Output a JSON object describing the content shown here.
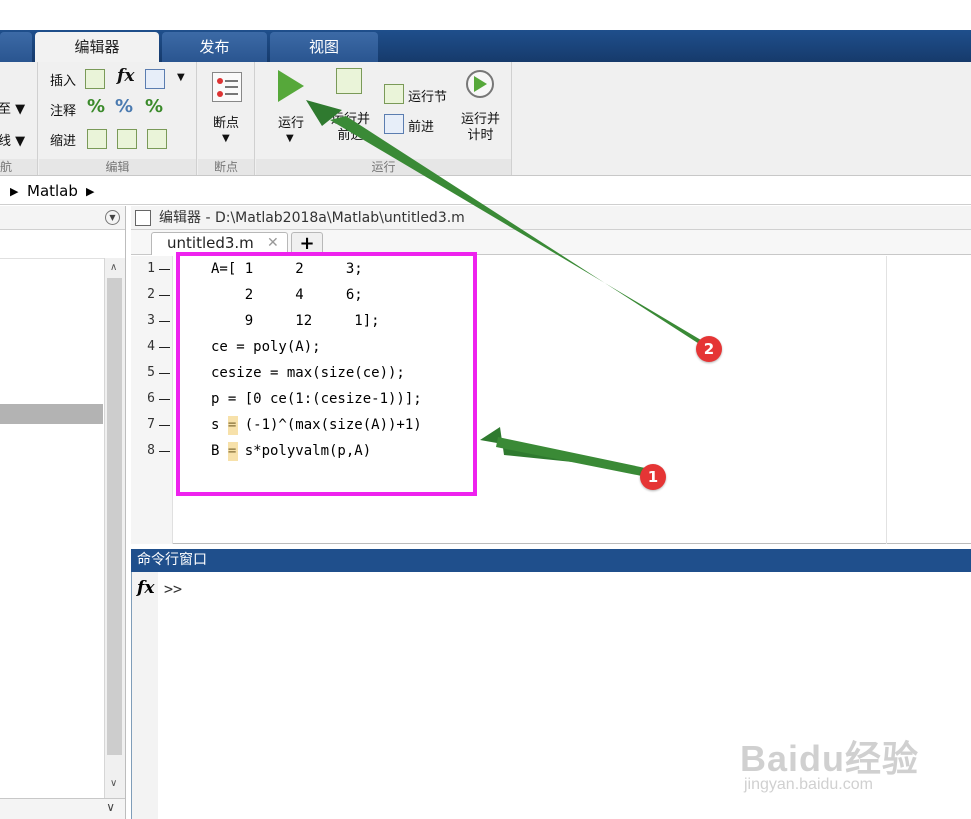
{
  "tabs": [
    {
      "label": "编辑器",
      "active": true
    },
    {
      "label": "发布",
      "active": false
    },
    {
      "label": "视图",
      "active": false
    }
  ],
  "ribbon": {
    "left_partial": [
      "至 ▼",
      "线 ▼",
      "航"
    ],
    "edit_section": {
      "title": "编辑",
      "insert_label": "插入",
      "comment_label": "注释",
      "indent_label": "缩进",
      "fx_label": "fx"
    },
    "breakpoint_section": {
      "title": "断点",
      "button_label": "断点"
    },
    "run_section": {
      "title": "运行",
      "run_label": "运行",
      "run_advance_label": "运行并\n前进",
      "run_section_label": "运行节",
      "advance_label": "前进",
      "run_time_label": "运行并\n计时"
    }
  },
  "breadcrumb": [
    "Matlab"
  ],
  "editor": {
    "header": "编辑器 - D:\\Matlab2018a\\Matlab\\untitled3.m",
    "tab": "untitled3.m",
    "add_tab": "+",
    "lines": [
      {
        "n": "1",
        "code": "A=[ 1     2     3;"
      },
      {
        "n": "2",
        "code": "    2     4     6;"
      },
      {
        "n": "3",
        "code": "    9     12     1];"
      },
      {
        "n": "4",
        "code": "ce = poly(A);"
      },
      {
        "n": "5",
        "code": "cesize = max(size(ce));"
      },
      {
        "n": "6",
        "code": "p = [0 ce(1:(cesize-1))];"
      },
      {
        "n": "7",
        "code": "s = (-1)^(max(size(A))+1)"
      },
      {
        "n": "8",
        "code": "B = s*polyvalm(p,A)"
      }
    ]
  },
  "command_window": {
    "title": "命令行窗口",
    "fx": "fx",
    "prompt": ">>"
  },
  "annotations": [
    {
      "label": "1"
    },
    {
      "label": "2"
    }
  ],
  "watermark": {
    "brand": "Baidu经验",
    "url": "jingyan.baidu.com"
  },
  "colors": {
    "tabbar": "#1f4f8c",
    "highlight_box": "#ee22ee",
    "arrow": "#2f7a2f",
    "badge": "#e53535"
  }
}
